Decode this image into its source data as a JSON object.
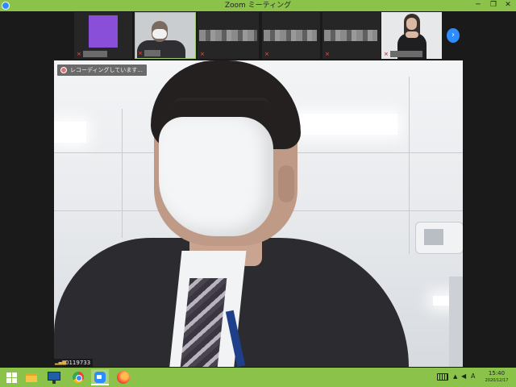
{
  "window": {
    "title": "Zoom ミーティング",
    "minimize_label": "─",
    "maximize_label": "❐",
    "close_label": "✕"
  },
  "filmstrip": {
    "participants": [
      {
        "name": "",
        "mic": "muted"
      },
      {
        "name": "",
        "mic": "muted"
      },
      {
        "name": "",
        "mic": "muted"
      },
      {
        "name": "",
        "mic": "muted"
      },
      {
        "name": "",
        "mic": "muted"
      },
      {
        "name": "",
        "mic": "muted"
      }
    ],
    "next_label": "›"
  },
  "main": {
    "recording_label": "レコーディングしています...",
    "participant_name": "0119733",
    "signal_glyph": "▂▄▆"
  },
  "taskbar": {
    "clock_time": "15:40",
    "clock_date": "2020/12/17",
    "ime_label": "A",
    "tray_up": "▲",
    "speaker_glyph": "◀",
    "accent_color": "#8bc34a"
  }
}
